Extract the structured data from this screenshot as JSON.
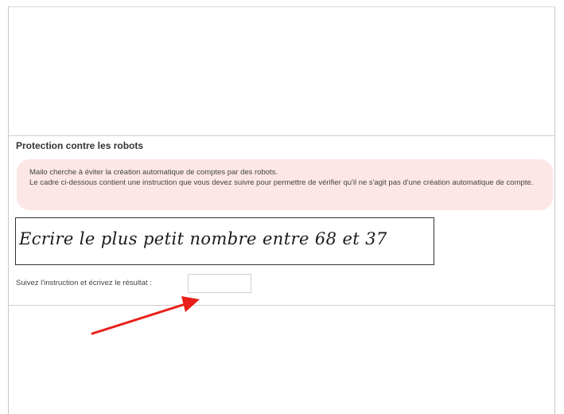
{
  "section": {
    "title": "Protection contre les robots"
  },
  "notice": {
    "line1": "Mailo cherche à éviter la création automatique de comptes par des robots.",
    "line2": "Le cadre ci-dessous contient une instruction que vous devez suivre pour permettre de vérifier qu'il ne s'agit pas d'une création automatique de compte."
  },
  "captcha": {
    "instruction": "Ecrire le plus petit nombre entre 68 et 37"
  },
  "answer": {
    "label": "Suivez l'instruction et écrivez le résultat :",
    "value": ""
  },
  "colors": {
    "notice_background": "#fde6e6",
    "arrow": "#e8201a"
  }
}
